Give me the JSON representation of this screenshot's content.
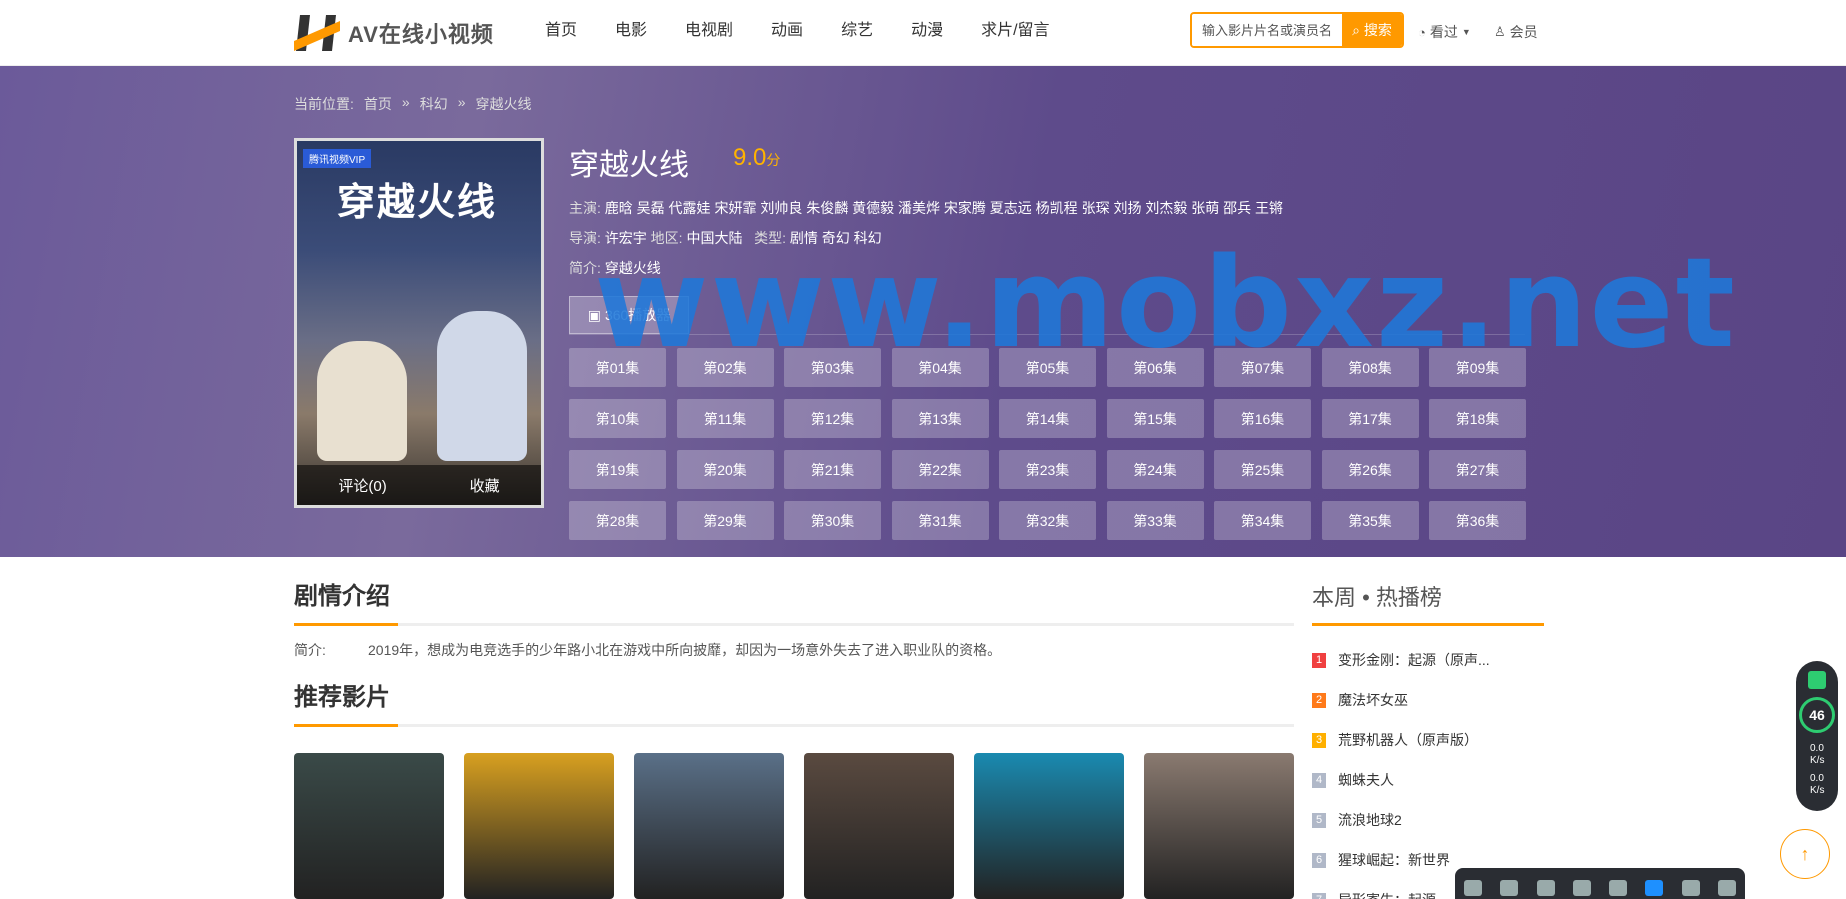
{
  "header": {
    "logo_text": "AV在线小视频",
    "nav": [
      "首页",
      "电影",
      "电视剧",
      "动画",
      "综艺",
      "动漫",
      "求片/留言"
    ],
    "search_placeholder": "输入影片片名或演员名称",
    "search_button": "搜索",
    "watched": "看过",
    "member": "会员"
  },
  "breadcrumb": {
    "label": "当前位置:",
    "home": "首页",
    "category": "科幻",
    "current": "穿越火线",
    "sep": "»"
  },
  "movie": {
    "title": "穿越火线",
    "score": "9.0",
    "score_unit": "分",
    "cast_label": "主演:",
    "cast": "鹿晗 吴磊 代露娃 宋妍霏 刘帅良 朱俊麟 黄德毅 潘美烨 宋家腾 夏志远 杨凯程 张琛 刘扬 刘杰毅 张萌 邵兵 王锵",
    "director_label": "导演:",
    "director": "许宏宇",
    "region_label": "地区:",
    "region": "中国大陆",
    "type_label": "类型:",
    "type": "剧情 奇幻 科幻",
    "intro_label": "简介:",
    "intro": "穿越火线",
    "poster_title": "穿越火线",
    "poster_badge": "腾讯视频VIP",
    "comment": "评论(0)",
    "favorite": "收藏",
    "play_source": "360播放器"
  },
  "episodes": [
    "第01集",
    "第02集",
    "第03集",
    "第04集",
    "第05集",
    "第06集",
    "第07集",
    "第08集",
    "第09集",
    "第10集",
    "第11集",
    "第12集",
    "第13集",
    "第14集",
    "第15集",
    "第16集",
    "第17集",
    "第18集",
    "第19集",
    "第20集",
    "第21集",
    "第22集",
    "第23集",
    "第24集",
    "第25集",
    "第26集",
    "第27集",
    "第28集",
    "第29集",
    "第30集",
    "第31集",
    "第32集",
    "第33集",
    "第34集",
    "第35集",
    "第36集"
  ],
  "watermark": "www.mobxz.net",
  "plot": {
    "title": "剧情介绍",
    "label": "简介:",
    "text": "2019年，想成为电竞选手的少年路小北在游戏中所向披靡，却因为一场意外失去了进入职业队的资格。"
  },
  "recommend": {
    "title": "推荐影片",
    "colors": [
      "#3a4a48",
      "#d8a020",
      "#5a7088",
      "#5a4a40",
      "#1a8ab0",
      "#8a7a70"
    ]
  },
  "hot": {
    "title": "本周 • 热播榜",
    "items": [
      {
        "num": "1",
        "name": "变形金刚：起源（原声...",
        "color": "#f04040"
      },
      {
        "num": "2",
        "name": "魔法坏女巫",
        "color": "#ff7a1a"
      },
      {
        "num": "3",
        "name": "荒野机器人（原声版）",
        "color": "#ffb000"
      },
      {
        "num": "4",
        "name": "蜘蛛夫人",
        "color": "#b0b8c8"
      },
      {
        "num": "5",
        "name": "流浪地球2",
        "color": "#b0b8c8"
      },
      {
        "num": "6",
        "name": "猩球崛起：新世界",
        "color": "#b0b8c8"
      },
      {
        "num": "7",
        "name": "异形寄生：起源",
        "color": "#b0b8c8"
      }
    ]
  },
  "speed_widget": {
    "percent": "46",
    "up": "0.0",
    "down": "0.0",
    "unit": "K/s"
  },
  "back_to_top": "↑"
}
